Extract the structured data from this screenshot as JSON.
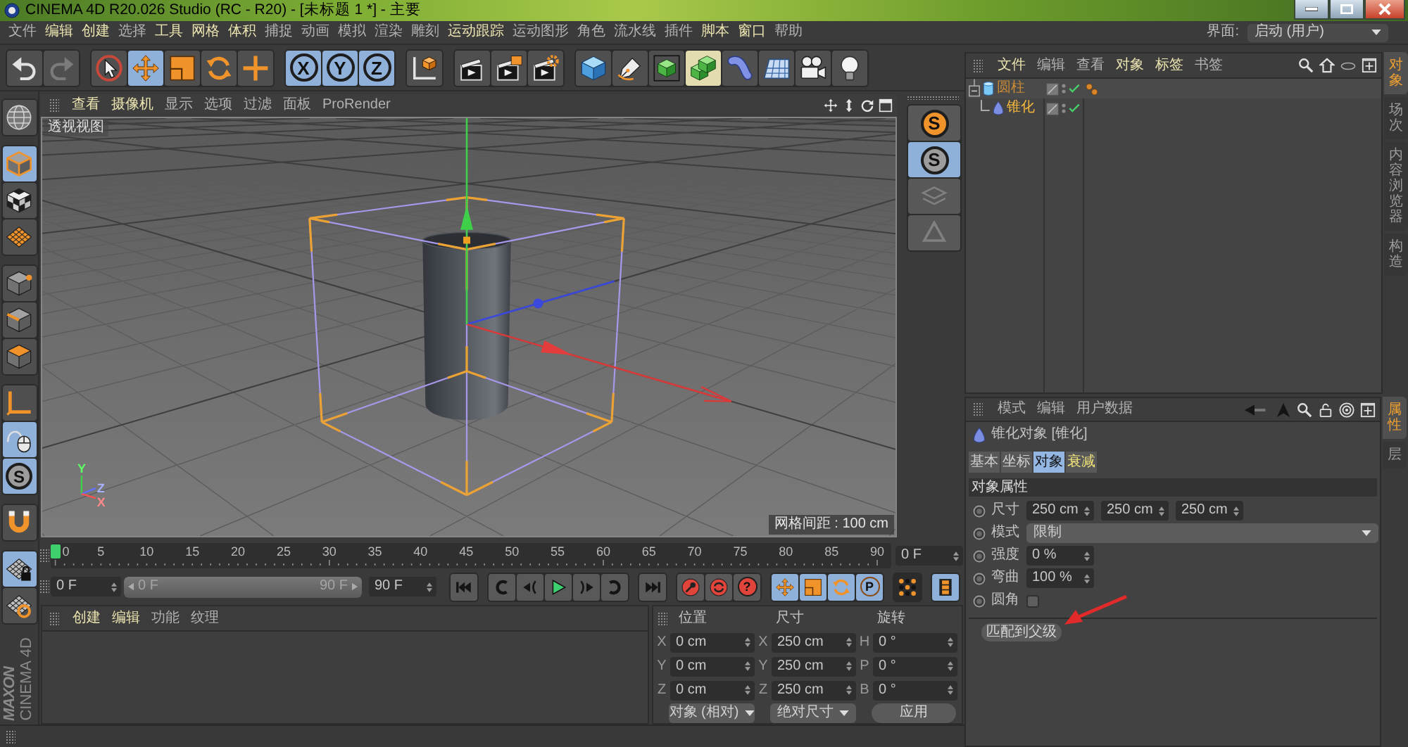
{
  "window": {
    "title": "CINEMA 4D R20.026 Studio (RC - R20) - [未标题 1 *] - 主要"
  },
  "menu_bar": {
    "items": [
      {
        "label": "文件",
        "emphasized": false
      },
      {
        "label": "编辑",
        "emphasized": true
      },
      {
        "label": "创建",
        "emphasized": true
      },
      {
        "label": "选择",
        "emphasized": false
      },
      {
        "label": "工具",
        "emphasized": true
      },
      {
        "label": "网格",
        "emphasized": true
      },
      {
        "label": "体积",
        "emphasized": true
      },
      {
        "label": "捕捉",
        "emphasized": false
      },
      {
        "label": "动画",
        "emphasized": false
      },
      {
        "label": "模拟",
        "emphasized": false
      },
      {
        "label": "渲染",
        "emphasized": false
      },
      {
        "label": "雕刻",
        "emphasized": false
      },
      {
        "label": "运动跟踪",
        "emphasized": true
      },
      {
        "label": "运动图形",
        "emphasized": false
      },
      {
        "label": "角色",
        "emphasized": false
      },
      {
        "label": "流水线",
        "emphasized": false
      },
      {
        "label": "插件",
        "emphasized": false
      },
      {
        "label": "脚本",
        "emphasized": true
      },
      {
        "label": "窗口",
        "emphasized": true
      },
      {
        "label": "帮助",
        "emphasized": false
      }
    ],
    "layout_label": "界面:",
    "layout_value": "启动 (用户)"
  },
  "toolbar": {
    "groups": [
      [
        {
          "kind": "undo",
          "selected": false,
          "disabled": false
        },
        {
          "kind": "redo",
          "selected": false,
          "disabled": true
        }
      ],
      [
        {
          "kind": "select",
          "selected": false
        },
        {
          "kind": "move",
          "selected": true
        },
        {
          "kind": "scale",
          "selected": false
        },
        {
          "kind": "rotate",
          "selected": false
        },
        {
          "kind": "cross",
          "selected": false
        }
      ],
      [
        {
          "kind": "axis",
          "label": "X",
          "selected": true
        },
        {
          "kind": "axis",
          "label": "Y",
          "selected": true
        },
        {
          "kind": "axis",
          "label": "Z",
          "selected": true
        }
      ],
      [
        {
          "kind": "coord-system",
          "selected": false
        }
      ],
      [
        {
          "kind": "render-view",
          "selected": false
        },
        {
          "kind": "render-viewer",
          "selected": false
        },
        {
          "kind": "render-settings",
          "selected": false
        }
      ],
      [
        {
          "kind": "cube",
          "selected": false,
          "highlighted": false
        },
        {
          "kind": "pen",
          "selected": false,
          "highlighted": false
        },
        {
          "kind": "subdivision",
          "selected": false,
          "highlighted": false
        },
        {
          "kind": "cloner",
          "selected": false,
          "highlighted": true
        },
        {
          "kind": "deformer",
          "selected": false,
          "highlighted": false
        },
        {
          "kind": "floor",
          "selected": false,
          "highlighted": false
        },
        {
          "kind": "camera",
          "selected": false,
          "highlighted": false
        },
        {
          "kind": "light",
          "selected": false,
          "highlighted": false
        }
      ]
    ]
  },
  "left_toolbar": {
    "groups": [
      [
        {
          "kind": "make-editable",
          "selected": false
        }
      ],
      [
        {
          "kind": "model",
          "selected": true
        },
        {
          "kind": "texture",
          "selected": false
        },
        {
          "kind": "workplane",
          "selected": false
        }
      ],
      [
        {
          "kind": "points",
          "selected": false
        },
        {
          "kind": "edges",
          "selected": false
        },
        {
          "kind": "polygons",
          "selected": false
        }
      ],
      [
        {
          "kind": "axis-mode",
          "selected": false
        },
        {
          "kind": "tweak",
          "selected": true
        },
        {
          "kind": "snap",
          "label": "S",
          "selected": true
        }
      ],
      [
        {
          "kind": "magnet",
          "selected": false
        }
      ],
      [
        {
          "kind": "locked-workplane",
          "selected": true
        },
        {
          "kind": "planar",
          "selected": false
        }
      ]
    ],
    "logo": {
      "brand": "MAXON",
      "product": "CINEMA 4D"
    }
  },
  "viewport": {
    "menu": [
      {
        "label": "查看",
        "emphasized": true
      },
      {
        "label": "摄像机",
        "emphasized": true
      },
      {
        "label": "显示",
        "emphasized": false
      },
      {
        "label": "选项",
        "emphasized": false
      },
      {
        "label": "过滤",
        "emphasized": false
      },
      {
        "label": "面板",
        "emphasized": false
      },
      {
        "label": "ProRender",
        "emphasized": false
      }
    ],
    "view_name": "透视视图",
    "grid_info": "网格间距 : 100 cm",
    "axis_labels": [
      "Y",
      "Z",
      "X"
    ]
  },
  "view_toolbar": {
    "items": [
      {
        "kind": "solo",
        "label": "S",
        "selected": false,
        "disabled": false
      },
      {
        "kind": "solo-off",
        "label": "S",
        "selected": true,
        "disabled": false
      },
      {
        "kind": "layers",
        "selected": false,
        "disabled": true
      },
      {
        "kind": "recycle",
        "selected": false,
        "disabled": true
      }
    ]
  },
  "timeline": {
    "ticks": [
      "0",
      "5",
      "10",
      "15",
      "20",
      "25",
      "30",
      "35",
      "40",
      "45",
      "50",
      "55",
      "60",
      "65",
      "70",
      "75",
      "80",
      "85",
      "90"
    ],
    "level": 0,
    "current_frame": "0 F",
    "start_frame": "0 F",
    "range": {
      "start": "0 F",
      "end": "90 F",
      "level": 1
    },
    "end_frame": "90 F",
    "transport": [
      [
        {
          "kind": "go-start",
          "selected": false
        }
      ],
      [
        {
          "kind": "prev-key",
          "selected": false
        },
        {
          "kind": "step-back",
          "selected": false
        },
        {
          "kind": "play",
          "selected": false
        },
        {
          "kind": "step-forward",
          "selected": false
        },
        {
          "kind": "next-key",
          "selected": false
        }
      ],
      [
        {
          "kind": "go-end",
          "selected": false
        }
      ],
      [
        {
          "kind": "record-key",
          "selected": false
        },
        {
          "kind": "auto-key",
          "selected": false
        },
        {
          "kind": "key-help",
          "label": "?",
          "selected": false
        }
      ],
      [
        {
          "kind": "key-move",
          "selected": true
        },
        {
          "kind": "key-scale",
          "selected": true
        },
        {
          "kind": "key-rotate",
          "selected": true
        },
        {
          "kind": "key-param",
          "label": "P",
          "selected": true
        }
      ],
      [
        {
          "kind": "key-points",
          "selected": false
        }
      ],
      [
        {
          "kind": "film",
          "selected": true
        }
      ]
    ]
  },
  "material_manager": {
    "menu": [
      {
        "label": "创建",
        "emphasized": true
      },
      {
        "label": "编辑",
        "emphasized": true
      },
      {
        "label": "功能",
        "emphasized": false
      },
      {
        "label": "纹理",
        "emphasized": false
      }
    ]
  },
  "coordinates": {
    "columns": [
      {
        "title": "位置",
        "fields": [
          {
            "axis": "X",
            "value": "0 cm"
          },
          {
            "axis": "Y",
            "value": "0 cm"
          },
          {
            "axis": "Z",
            "value": "0 cm"
          }
        ]
      },
      {
        "title": "尺寸",
        "fields": [
          {
            "axis": "X",
            "value": "250 cm"
          },
          {
            "axis": "Y",
            "value": "250 cm"
          },
          {
            "axis": "Z",
            "value": "250 cm"
          }
        ]
      },
      {
        "title": "旋转",
        "fields": [
          {
            "axis": "H",
            "value": "0 °"
          },
          {
            "axis": "P",
            "value": "0 °"
          },
          {
            "axis": "B",
            "value": "0 °"
          }
        ]
      }
    ],
    "dropdowns": [
      "对象 (相对)",
      "绝对尺寸"
    ],
    "apply_button": "应用"
  },
  "object_manager": {
    "menu": [
      {
        "label": "文件",
        "emphasized": true
      },
      {
        "label": "编辑",
        "emphasized": false
      },
      {
        "label": "查看",
        "emphasized": false
      },
      {
        "label": "对象",
        "emphasized": true
      },
      {
        "label": "标签",
        "emphasized": true
      },
      {
        "label": "书签",
        "emphasized": false
      }
    ],
    "objects": [
      {
        "name": "圆柱",
        "kind": "cylinder",
        "selected": false,
        "enabled": true,
        "expanded": true,
        "tags": [
          {
            "kind": "phong"
          }
        ],
        "children": [
          {
            "name": "锥化",
            "kind": "deformer",
            "selected": true,
            "enabled": true
          }
        ]
      }
    ],
    "side_tabs": [
      {
        "label": "对象",
        "selected": true
      },
      {
        "label": "场次",
        "selected": false
      },
      {
        "label": "内容浏览器",
        "selected": false
      },
      {
        "label": "构造",
        "selected": false
      }
    ]
  },
  "attribute_manager": {
    "menu": [
      "模式",
      "编辑",
      "用户数据"
    ],
    "object_title": "锥化对象 [锥化]",
    "tabs": [
      {
        "label": "基本",
        "selected": false,
        "emphasized": false
      },
      {
        "label": "坐标",
        "selected": false,
        "emphasized": false
      },
      {
        "label": "对象",
        "selected": true,
        "emphasized": false
      },
      {
        "label": "衰减",
        "selected": false,
        "emphasized": true
      }
    ],
    "section": "对象属性",
    "params": [
      {
        "kind": "vector",
        "label": "尺寸",
        "values": [
          "250 cm",
          "250 cm",
          "250 cm"
        ]
      },
      {
        "kind": "dropdown",
        "label": "模式",
        "value": "限制"
      },
      {
        "kind": "number",
        "label": "强度",
        "value": "0 %"
      },
      {
        "kind": "number",
        "label": "弯曲",
        "value": "100 %"
      },
      {
        "kind": "checkbox",
        "label": "圆角",
        "checked": false
      }
    ],
    "button": "匹配到父级",
    "side_tabs": [
      {
        "label": "属性",
        "selected": true
      },
      {
        "label": "层",
        "selected": false
      }
    ]
  }
}
